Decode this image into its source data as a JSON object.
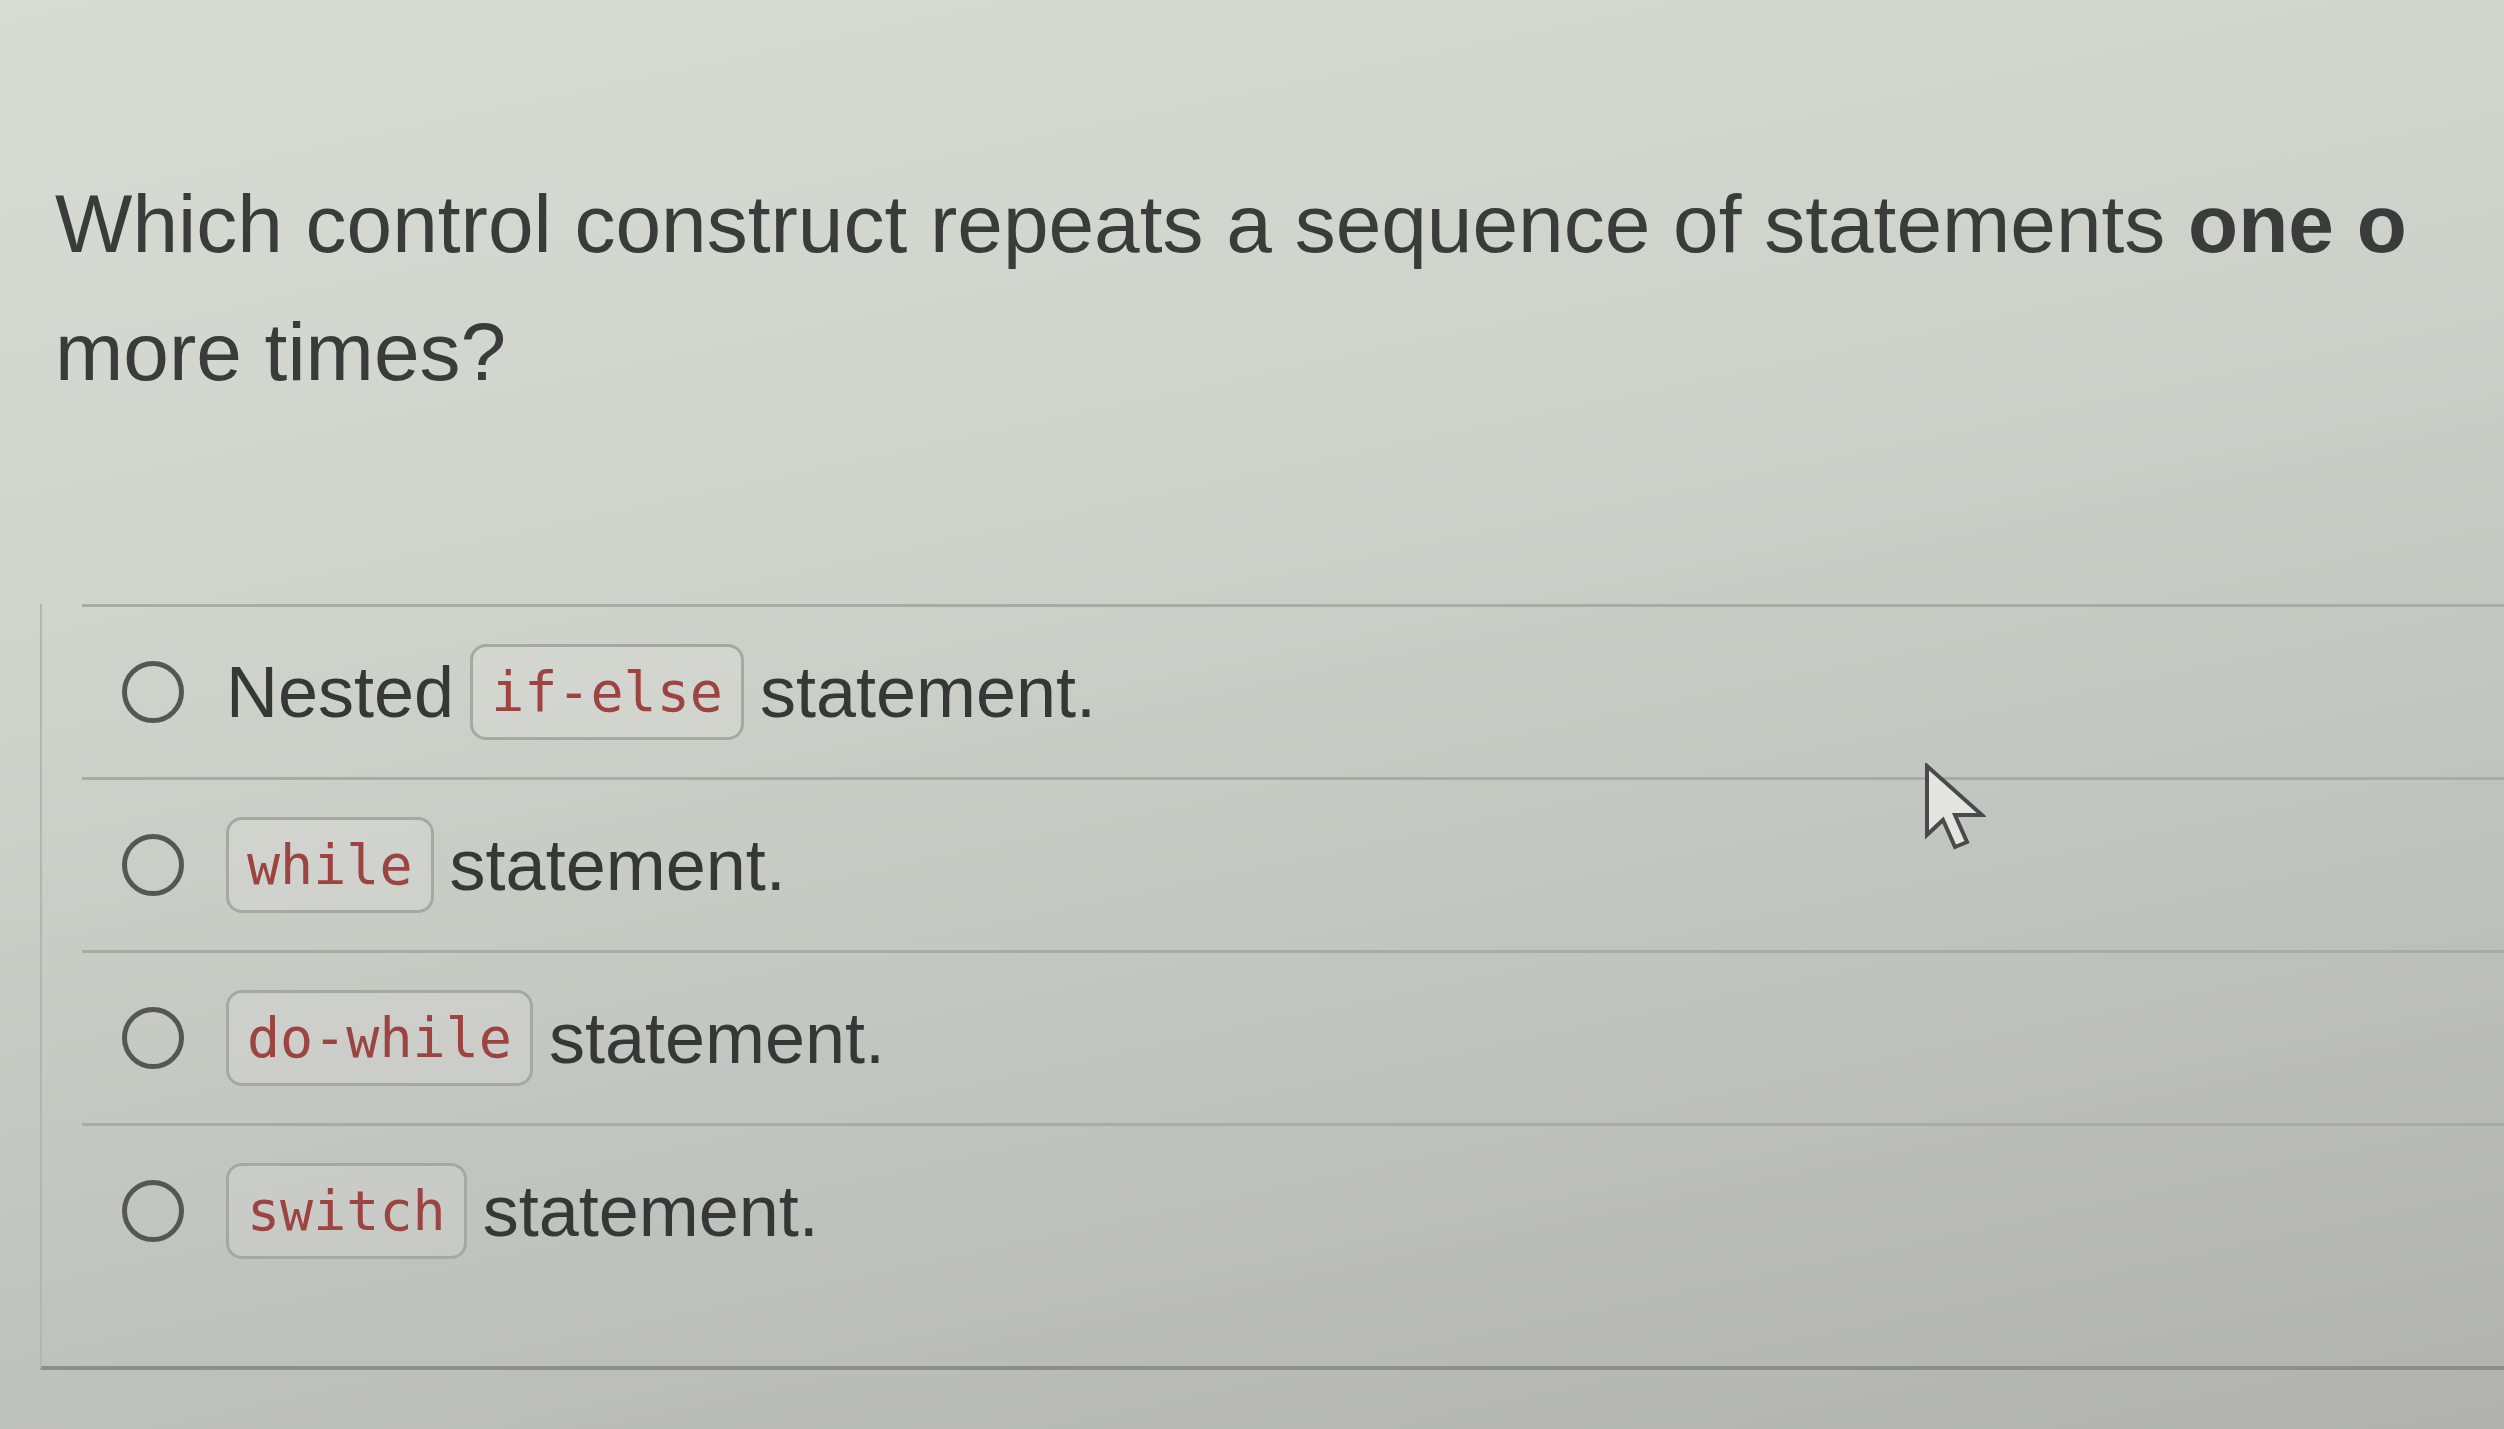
{
  "question": {
    "lines": [
      "Which control construct repeats a sequence of statements **one o**",
      "more times?"
    ]
  },
  "options": [
    {
      "selected": false,
      "parts": [
        {
          "kind": "text",
          "text": "Nested"
        },
        {
          "kind": "code",
          "text": "if-else"
        },
        {
          "kind": "text",
          "text": "statement."
        }
      ]
    },
    {
      "selected": false,
      "parts": [
        {
          "kind": "code",
          "text": "while"
        },
        {
          "kind": "text",
          "text": "statement."
        }
      ]
    },
    {
      "selected": false,
      "parts": [
        {
          "kind": "code",
          "text": "do-while"
        },
        {
          "kind": "text",
          "text": "statement."
        }
      ]
    },
    {
      "selected": false,
      "parts": [
        {
          "kind": "code",
          "text": "switch"
        },
        {
          "kind": "text",
          "text": "statement."
        }
      ]
    }
  ]
}
